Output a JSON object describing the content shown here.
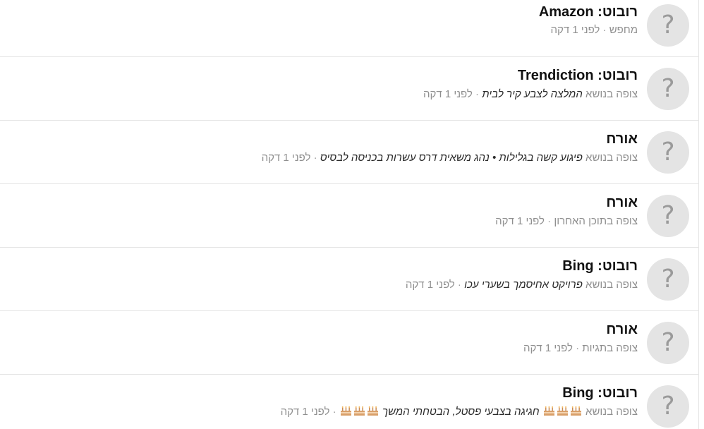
{
  "avatar_glyph": "?",
  "separator": " · ",
  "cake_icon": "birthday-cake-icon",
  "rows": [
    {
      "name": "רובוט: Amazon",
      "action": "מחפש",
      "topic": "",
      "time": "לפני 1 דקה"
    },
    {
      "name": "רובוט: Trendiction",
      "action": "צופה בנושא ",
      "topic": "המלצה לצבע קיר לבית",
      "time": "לפני 1 דקה"
    },
    {
      "name": "אורח",
      "action": "צופה בנושא ",
      "topic": "פיגוע קשה בגלילות • נהג משאית דרס עשרות בכניסה לבסיס",
      "time": "לפני 1 דקה"
    },
    {
      "name": "אורח",
      "action": "צופה בתוכן האחרון",
      "topic": "",
      "time": "לפני 1 דקה"
    },
    {
      "name": "רובוט: Bing",
      "action": "צופה בנושא ",
      "topic": "פרויקט אחיסמך בשערי עכו",
      "time": "לפני 1 דקה"
    },
    {
      "name": "אורח",
      "action": "צופה בתגיות",
      "topic": "",
      "time": "לפני 1 דקה"
    },
    {
      "name": "רובוט: Bing",
      "action": "צופה בנושא ",
      "topic": "חגיגה בצבעי פסטל, הבטחתי המשך",
      "time": "לפני 1 דקה"
    }
  ]
}
